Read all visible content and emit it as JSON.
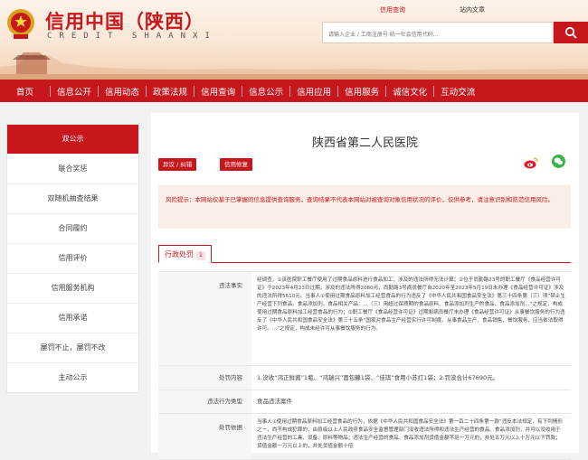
{
  "site": {
    "title_cn": "信用中国（陕西）",
    "title_en": "CREDIT SHAANXI",
    "link_query": "信用查询",
    "link_nav": "站内文章",
    "search_placeholder": "请输入企业 / 工商注册号 统一社会信用代码..."
  },
  "nav": [
    "首页",
    "信息公开",
    "信用动态",
    "政策法规",
    "信用查询",
    "信息公示",
    "信用应用",
    "信用服务",
    "诚信文化",
    "互动交流"
  ],
  "sidebar": [
    "双公示",
    "联合奖惩",
    "双随机抽查结果",
    "合同履约",
    "信用评价",
    "信用服务机构",
    "信用承诺",
    "屡罚不止，屡罚不改",
    "主动公示"
  ],
  "main": {
    "company": "陕西省第二人民医院",
    "btn_objection": "异议 / 纠错",
    "btn_repair": "信用修复",
    "tip": "风险提示：本网站仅基于已掌握的信息提供查询服务，查询结果不代表本网站对被查询对象信用状况的评价，仅供参考，请注意识别和防范信用风险。",
    "tab": "行政处罚",
    "tab_count": "1",
    "rows": [
      {
        "label": "违法事实",
        "value": "经调查，①该医院职工餐厅使用了过期食品原料进行食品加工，涉及的违法所得无法计算；②位于尚勤路23号的职工餐厅《食品经营许可证》于2023年4月23日过期，涉及的违法所得2080元，尚勤路3号病员餐厅自2020年至2023年5月19日未办理《食品经营许可证》涉及的违法所得5610元。当事人①使用过期食品原料加工经营食品的行为违反了《中华人民共和国食品安全法》第三十四条第（三）项“禁止生产经营下列食品、食品添加剂、食品相关产品：...（三）用超过保质期的食品原料、食品添加剂生产的食品、食品添加剂...”之规定，构成使用过期食品原料加工经营食品的行为；②职工餐厅《食品经营许可证》过期和病员餐厅未办理《食品经营许可证》从事餐饮服务的行为违反了《中华人民共和国食品安全法》第三十五条“国家对食品生产经营实行许可制度。从事食品生产、食品销售、餐饮服务，应当依法取得许可。...”之规定，构成未经许可从事餐饮服务的行为。"
      },
      {
        "label": "处罚内容",
        "value": "1.没收“鸿正鲜酱”1瓶、“鸿瑞兴”面包糠1袋、“佳琪”食用小苏打1袋；2.罚没合计67690元。"
      },
      {
        "label": "违法行为类型",
        "value": "食品违法案件"
      },
      {
        "label": "处罚依据",
        "value": "当事人①使用过期食品原料加工经营食品的行为，依据《中华人民共和国食品安全法》第一百二十四条第一款“违反本法规定，有下列情形之一，尚不构成犯罪的，由县级以上人民政府食品安全监督管理部门没收违法所得和违法生产经营的食品、食品添加剂，并可以没收用于违法生产经营的工具、设备、原料等物品；违法生产经营的食品、食品添加剂货值金额不足一万元的，并处五万元以上十万元以下罚款；货值金额一万元以上的，并处货值金额十倍"
      }
    ]
  },
  "colors": {
    "brand_red": "#c8161d",
    "tip_bg": "#fbeee6",
    "wechat_green": "#3bb34a"
  },
  "icons": [
    "national-emblem-icon",
    "search-icon",
    "weibo-icon",
    "wechat-icon"
  ]
}
